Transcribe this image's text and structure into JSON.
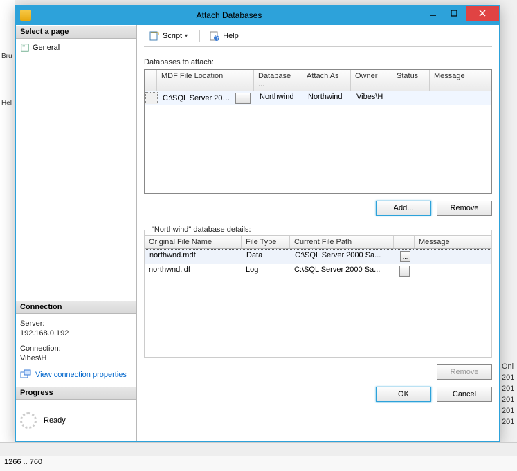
{
  "window": {
    "title": "Attach Databases"
  },
  "sidebar": {
    "select_page_header": "Select a page",
    "pages": [
      {
        "label": "General"
      }
    ],
    "connection_header": "Connection",
    "server_label": "Server:",
    "server_value": "192.168.0.192",
    "connection_label": "Connection:",
    "connection_value": "Vibes\\H",
    "view_props_link": "View connection properties",
    "progress_header": "Progress",
    "progress_status": "Ready"
  },
  "toolbar": {
    "script_label": "Script",
    "help_label": "Help"
  },
  "attach": {
    "label": "Databases to attach:",
    "columns": {
      "mdf": "MDF File Location",
      "db": "Database ...",
      "as": "Attach As",
      "owner": "Owner",
      "status": "Status",
      "message": "Message"
    },
    "rows": [
      {
        "mdf": "C:\\SQL Server 2000...",
        "browse": "...",
        "db": "Northwind",
        "as": "Northwind",
        "owner": "Vibes\\H",
        "status": "",
        "message": ""
      }
    ],
    "add_label": "Add...",
    "remove_label": "Remove"
  },
  "details": {
    "legend": "\"Northwind\" database details:",
    "columns": {
      "name": "Original File Name",
      "type": "File Type",
      "path": "Current File Path",
      "message": "Message"
    },
    "rows": [
      {
        "name": "northwnd.mdf",
        "type": "Data",
        "path": "C:\\SQL Server 2000 Sa...",
        "browse": "..."
      },
      {
        "name": "northwnd.ldf",
        "type": "Log",
        "path": "C:\\SQL Server 2000 Sa...",
        "browse": "..."
      }
    ],
    "remove_label": "Remove"
  },
  "footer": {
    "ok_label": "OK",
    "cancel_label": "Cancel"
  },
  "bg": {
    "left1": "Bru",
    "left2": "Hel",
    "right": [
      "Onl",
      "201",
      "201",
      "201",
      "201",
      "201"
    ],
    "status": "1266 .. 760"
  }
}
